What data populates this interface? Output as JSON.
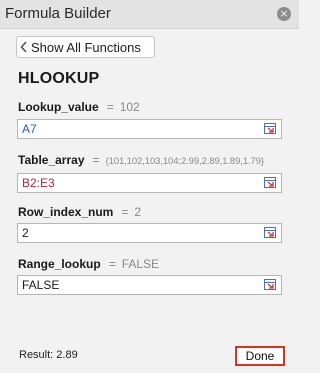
{
  "window": {
    "title": "Formula Builder",
    "close_glyph": "×"
  },
  "back_button": {
    "label": "Show All Functions",
    "icon": "chevron-left-icon"
  },
  "function": {
    "name": "HLOOKUP"
  },
  "arguments": [
    {
      "name": "Lookup_value",
      "eq": "=",
      "value": "102",
      "input": "A7",
      "input_color": "#2a59c9"
    },
    {
      "name": "Table_array",
      "eq": "=",
      "value": "{101,102,103,104;2.99,2.89,1.89,1.79}",
      "input": "B2:E3",
      "input_color": "#c0233a"
    },
    {
      "name": "Row_index_num",
      "eq": "=",
      "value": "2",
      "input": "2",
      "input_color": "#1a1a1a"
    },
    {
      "name": "Range_lookup",
      "eq": "=",
      "value": "FALSE",
      "input": "FALSE",
      "input_color": "#1a1a1a"
    }
  ],
  "footer": {
    "result": "Result: 2.89",
    "done_label": "Done"
  },
  "colors": {
    "highlight_border": "#e0301e",
    "ref_blue": "#2a59c9",
    "ref_red": "#c0233a"
  }
}
